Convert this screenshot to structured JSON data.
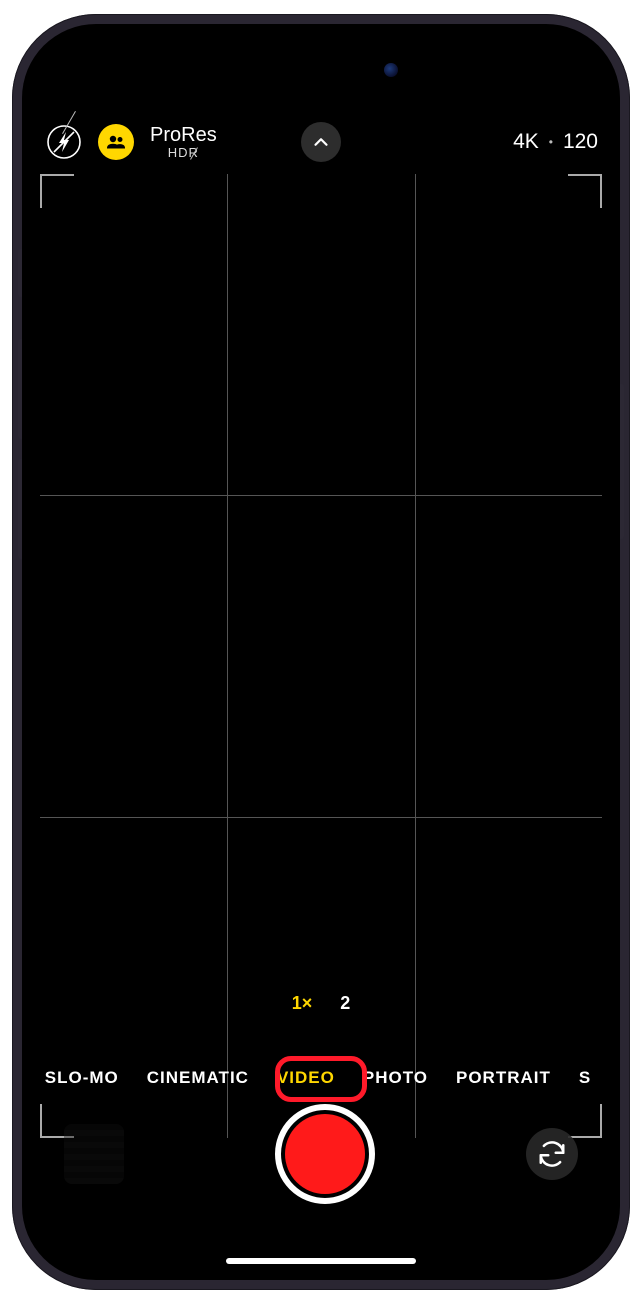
{
  "top": {
    "prores": "ProRes",
    "hdr": "HDR",
    "resolution": "4K",
    "fps": "120"
  },
  "zoom": {
    "options": [
      "1×",
      "2"
    ],
    "active_index": 0
  },
  "modes": {
    "items": [
      "SLO-MO",
      "CINEMATIC",
      "VIDEO",
      "PHOTO",
      "PORTRAIT",
      "S"
    ],
    "active_index": 2
  },
  "icons": {
    "flash": "flash-off-icon",
    "group": "group-icon",
    "chevron": "chevron-up-icon",
    "flip": "camera-flip-icon"
  }
}
